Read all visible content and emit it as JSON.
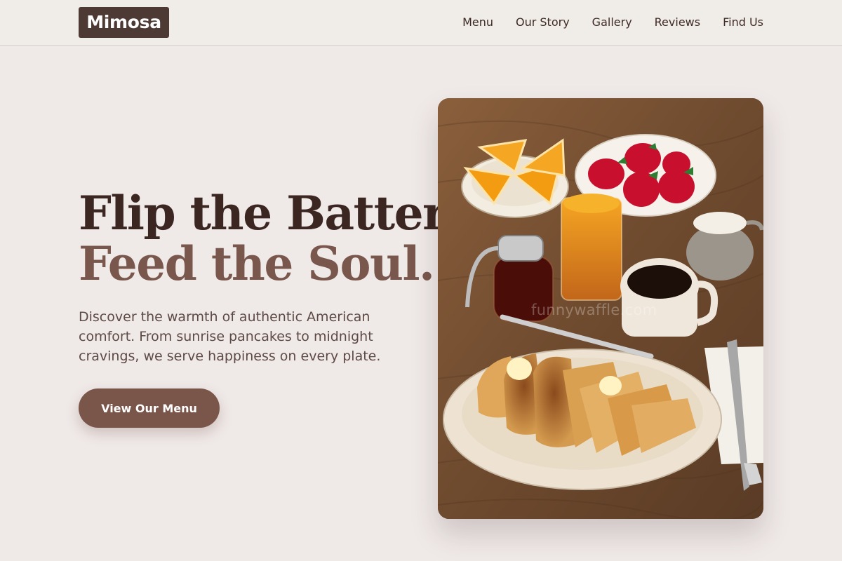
{
  "brand": {
    "logo_text": "Mimosa"
  },
  "nav": {
    "links": [
      "Menu",
      "Our Story",
      "Gallery",
      "Reviews",
      "Find Us"
    ]
  },
  "hero": {
    "title_line1": "Flip the Batter,",
    "title_line2": "Feed the Soul.",
    "subtitle": "Discover the warmth of authentic American comfort. From sunrise pancakes to midnight cravings, we serve happiness on every plate.",
    "cta_label": "View Our Menu"
  },
  "image": {
    "alt": "French toast breakfast with orange juice, coffee, strawberries, orange slices and syrup",
    "watermark": "funnywaffle.com"
  },
  "colors": {
    "page_bg": "#efe9e8",
    "logo_bg": "#4e3a35",
    "title_dark": "#3b2622",
    "title_accent": "#7a574c",
    "button_bg": "#7a5549"
  }
}
